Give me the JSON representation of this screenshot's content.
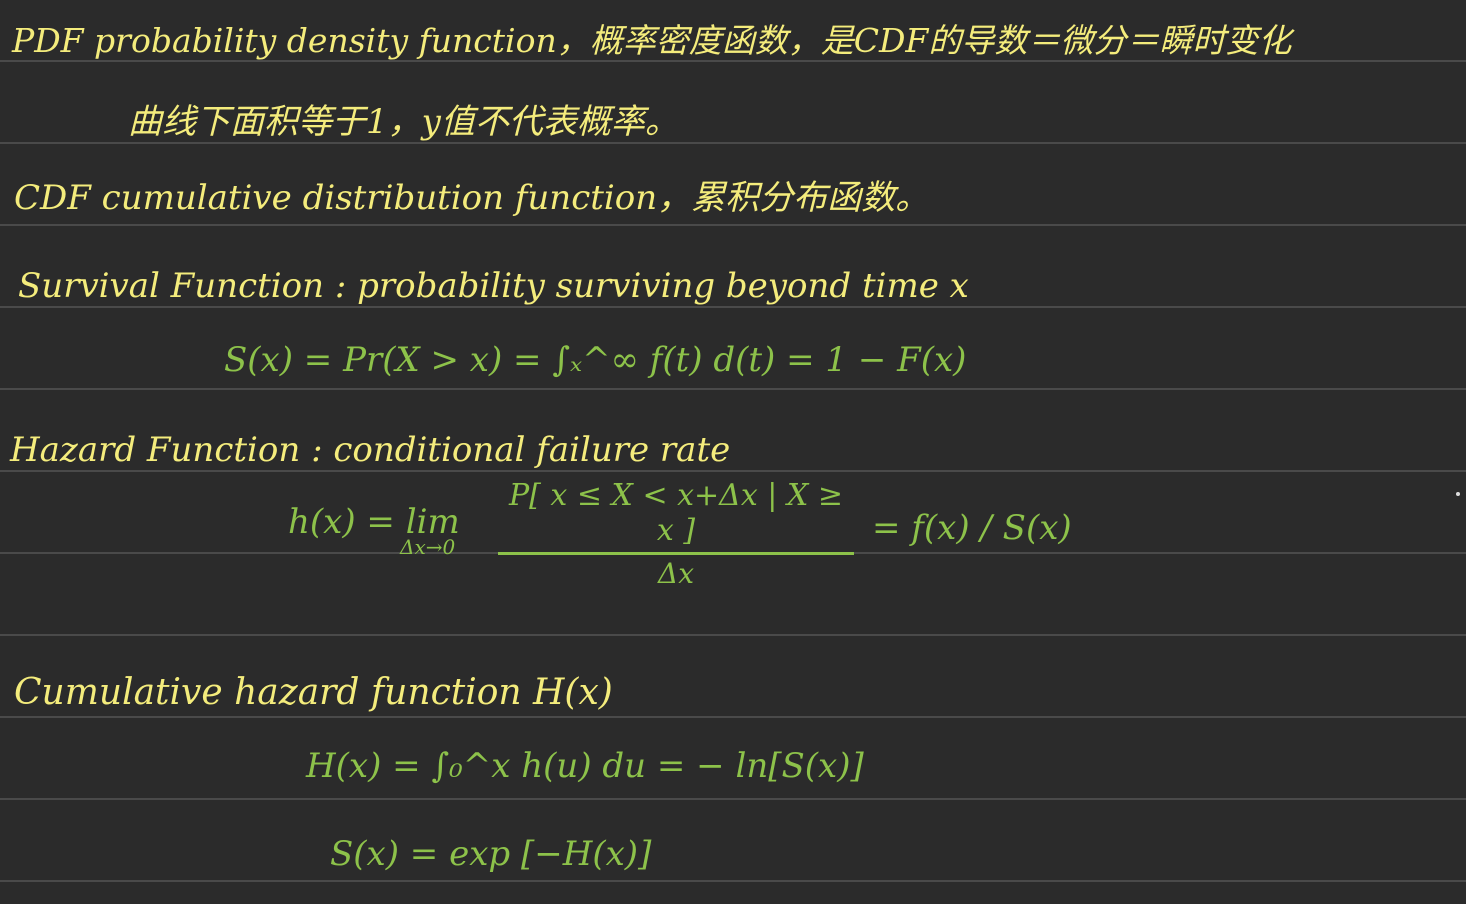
{
  "colors": {
    "background": "#2b2b2b",
    "rule": "#4a4a4a",
    "definition_text": "#f4ec7c",
    "formula_text": "#8dc24a"
  },
  "notes": {
    "pdf_line1": "PDF  probability density function，概率密度函数，是CDF的导数＝微分＝瞬时变化",
    "pdf_line2": "曲线下面积等于1，y值不代表概率。",
    "cdf_line": "CDF cumulative distribution function，累积分布函数。",
    "survival_def": "Survival Function : probability surviving beyond time x",
    "survival_eq": "S(x) = Pr(X > x) = ∫ₓ^∞ f(t) d(t) = 1 − F(x)",
    "hazard_def": "Hazard Function : conditional failure rate",
    "hazard_lhs": "h(x) = lim",
    "hazard_lim_sub": "Δx→0",
    "hazard_num": "P[ x ≤ X < x+Δx | X ≥ x ]",
    "hazard_den": "Δx",
    "hazard_rhs": "= f(x) / S(x)",
    "cumhaz_def": "Cumulative hazard function  H(x)",
    "cumhaz_eq": "H(x) = ∫₀^x h(u) du = − ln[S(x)]",
    "survival_exp_eq": "S(x) = exp [−H(x)]"
  }
}
